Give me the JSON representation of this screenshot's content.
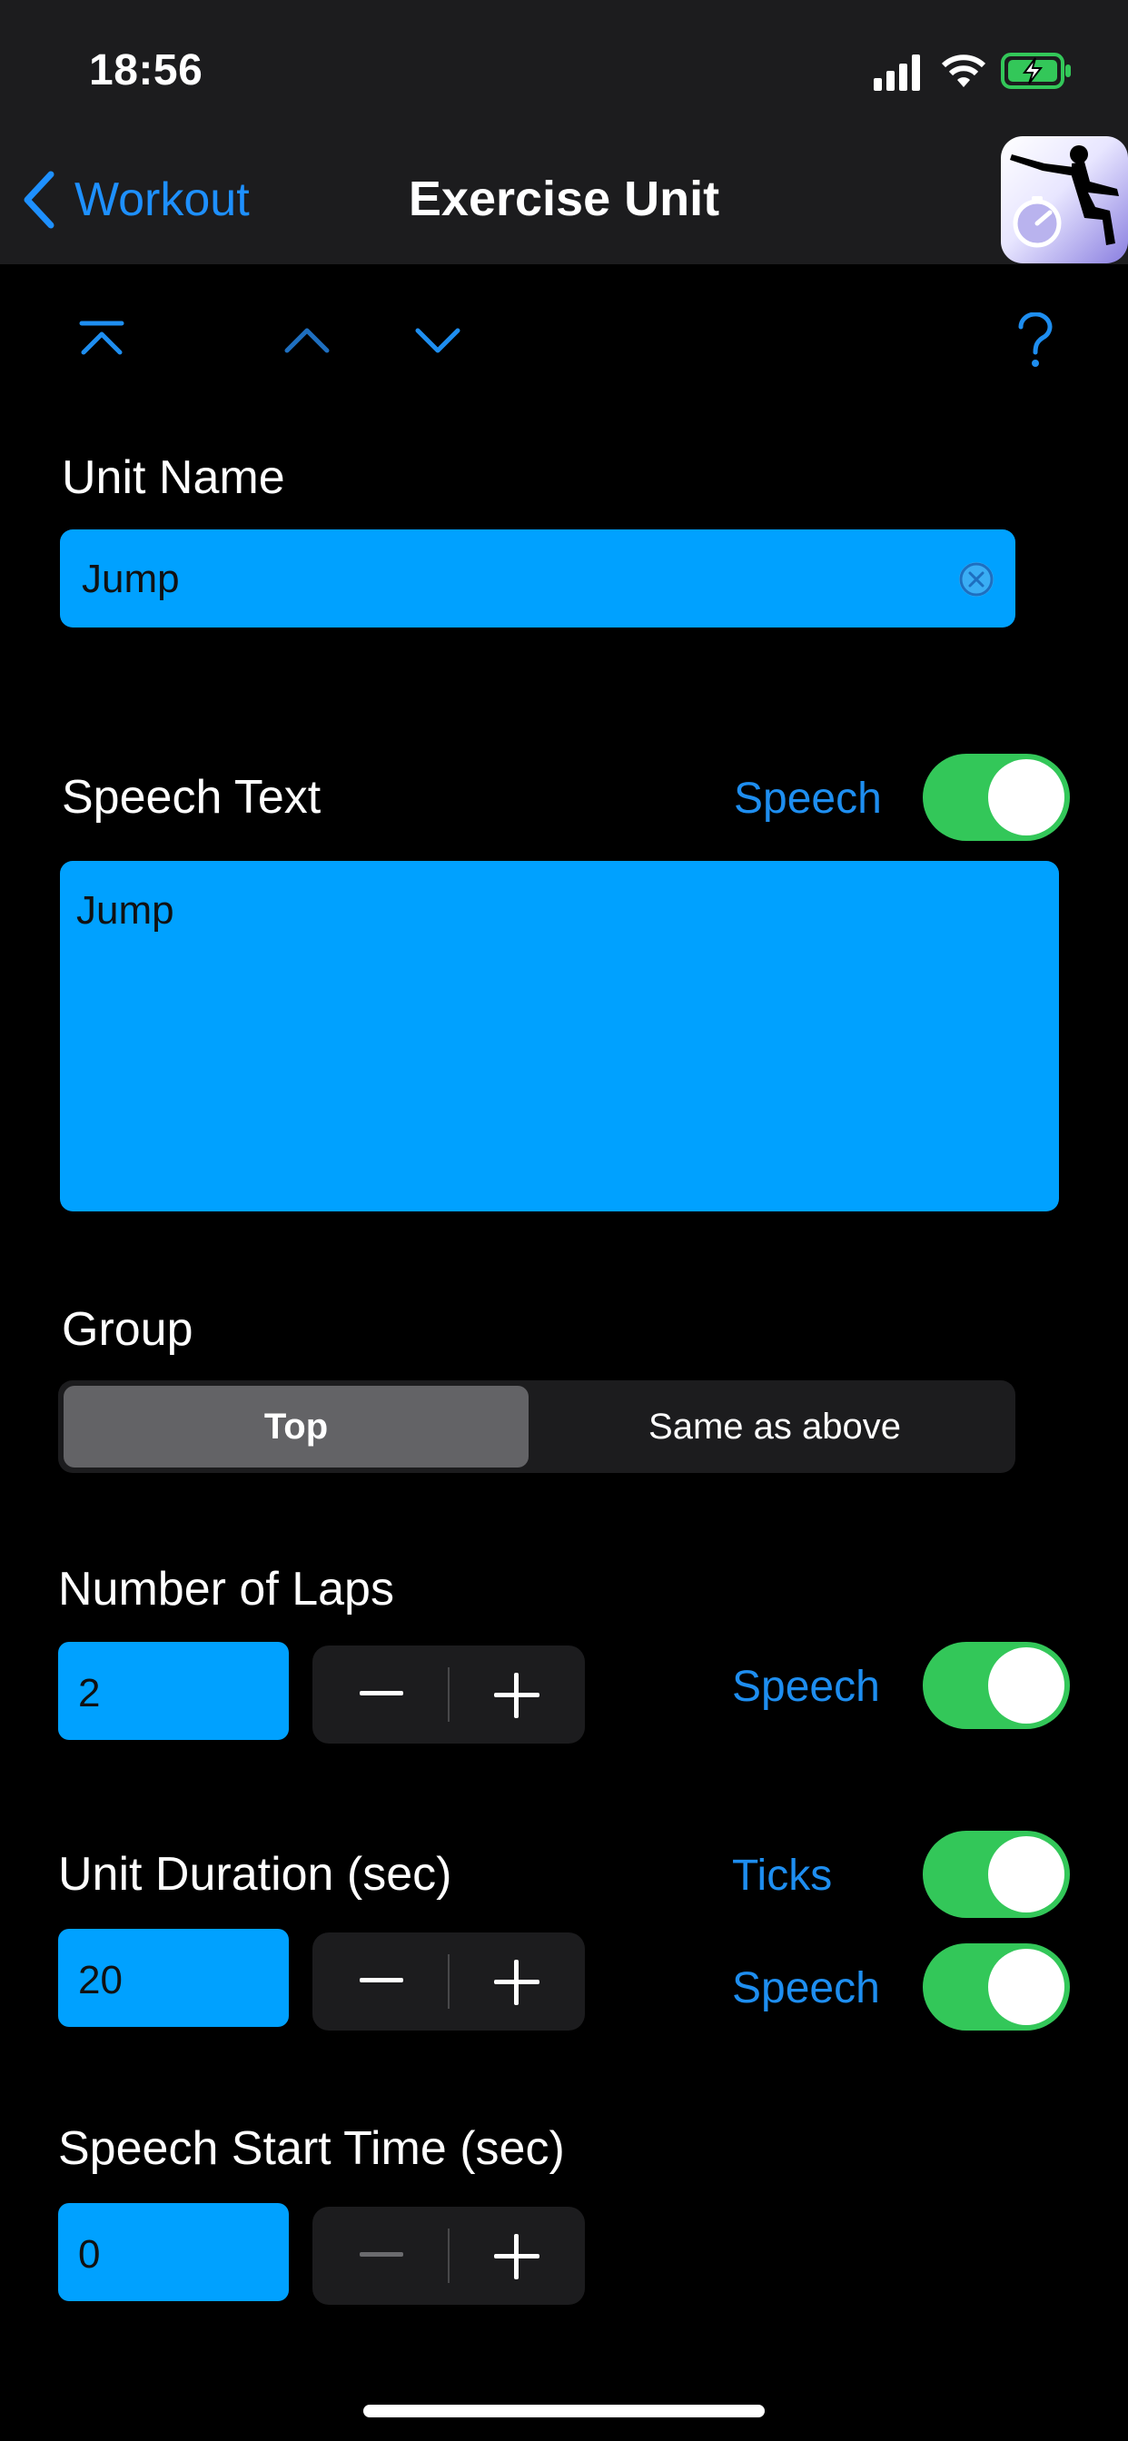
{
  "status_bar": {
    "time": "18:56"
  },
  "nav": {
    "back_label": "Workout",
    "title": "Exercise Unit"
  },
  "unit_name": {
    "label": "Unit Name",
    "value": "Jump"
  },
  "speech_text": {
    "label": "Speech Text",
    "toggle_label": "Speech",
    "toggle_on": true,
    "value": "Jump"
  },
  "group": {
    "label": "Group",
    "options": [
      "Top",
      "Same as above"
    ],
    "selected": "Top"
  },
  "laps": {
    "label": "Number of Laps",
    "value": "2",
    "speech_label": "Speech",
    "speech_on": true
  },
  "duration": {
    "label": "Unit Duration (sec)",
    "value": "20",
    "ticks_label": "Ticks",
    "ticks_on": true,
    "speech_label": "Speech",
    "speech_on": true
  },
  "speech_start": {
    "label": "Speech Start Time (sec)",
    "value": "0"
  },
  "colors": {
    "accent": "#1e8ef0",
    "field": "#00a1ff",
    "toggle_on": "#33c759",
    "background": "#000000",
    "bar": "#1c1c1e"
  },
  "icons": [
    "chevron-left-icon",
    "jump-to-top-icon",
    "chevron-up-icon",
    "chevron-down-icon",
    "help-icon",
    "clear-icon",
    "minus-icon",
    "plus-icon",
    "signal-icon",
    "wifi-icon",
    "battery-icon"
  ]
}
